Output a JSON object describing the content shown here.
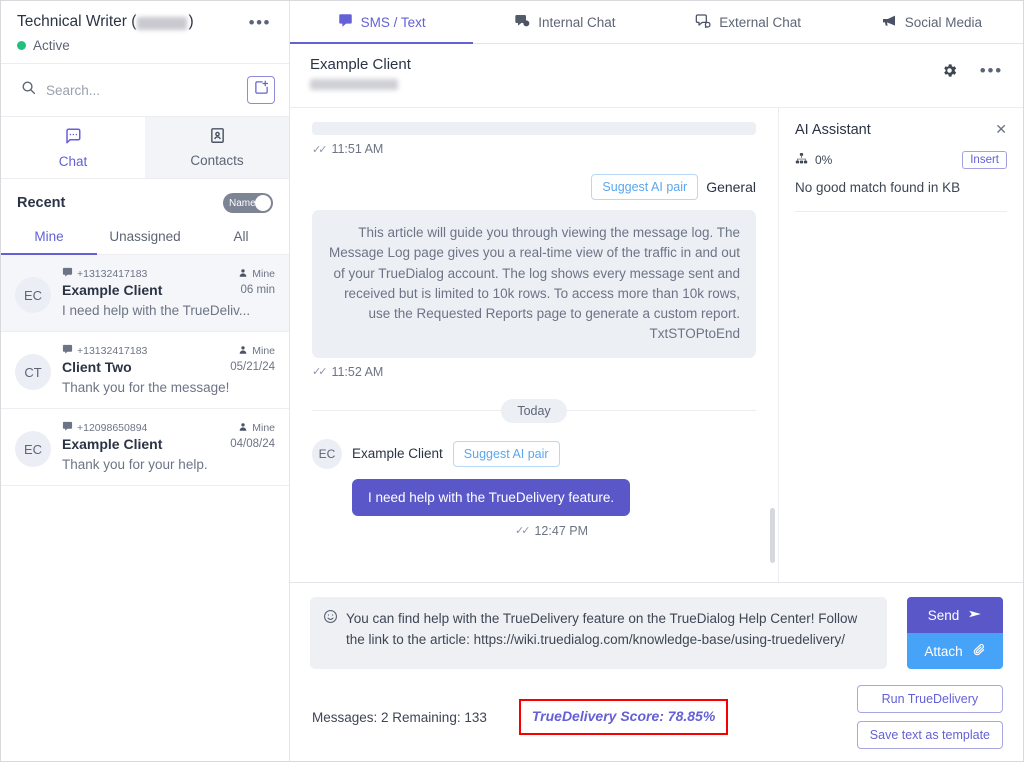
{
  "sidebar": {
    "user": {
      "name": "Technical Writer",
      "number_redacted": true,
      "status": "Active",
      "menu_icon": "ellipsis-icon"
    },
    "search": {
      "placeholder": "Search...",
      "value": "",
      "icon": "search-icon",
      "new_message_icon": "new-message-icon"
    },
    "tabs": [
      {
        "label": "Chat",
        "icon": "chat-bubble-icon",
        "active": true
      },
      {
        "label": "Contacts",
        "icon": "contact-card-icon",
        "active": false
      }
    ],
    "recent_label": "Recent",
    "sort_toggle": {
      "label": "Name",
      "on": true
    },
    "filters": [
      {
        "label": "Mine",
        "active": true
      },
      {
        "label": "Unassigned",
        "active": false
      },
      {
        "label": "All",
        "active": false
      }
    ],
    "conversations": [
      {
        "initials": "EC",
        "phone": "+13132417183",
        "name": "Example Client",
        "owner": "Mine",
        "time": "06 min",
        "preview": "I need help with the TrueDeliv...",
        "selected": true
      },
      {
        "initials": "CT",
        "phone": "+13132417183",
        "name": "Client Two",
        "owner": "Mine",
        "time": "05/21/24",
        "preview": "Thank you for the message!",
        "selected": false
      },
      {
        "initials": "EC",
        "phone": "+12098650894",
        "name": "Example Client",
        "owner": "Mine",
        "time": "04/08/24",
        "preview": "Thank you for your help.",
        "selected": false
      }
    ]
  },
  "channel_tabs": [
    {
      "label": "SMS / Text",
      "icon": "sms-icon",
      "active": true
    },
    {
      "label": "Internal Chat",
      "icon": "internal-chat-icon",
      "active": false
    },
    {
      "label": "External Chat",
      "icon": "external-chat-icon",
      "active": false
    },
    {
      "label": "Social Media",
      "icon": "megaphone-icon",
      "active": false
    }
  ],
  "chat_header": {
    "name": "Example Client",
    "number_redacted": true,
    "gear_icon": "gear-icon",
    "menu_icon": "ellipsis-icon"
  },
  "thread": {
    "messages": [
      {
        "direction": "outbound",
        "text": "",
        "empty": true,
        "time": "11:51 AM",
        "status_icon": "double-check-icon"
      },
      {
        "direction": "outbound",
        "suggest_button": "Suggest AI pair",
        "tag": "General",
        "text": "This article will guide you through viewing the message log. The Message Log page gives you a real-time view of the traffic in and out of your TrueDialog account. The log shows every message sent and received but is limited to 10k rows. To access more than 10k rows, use the Requested Reports page to generate a custom report. TxtSTOPtoEnd",
        "time": "11:52 AM",
        "status_icon": "double-check-icon"
      }
    ],
    "day_divider": "Today",
    "inbound": {
      "initials": "EC",
      "sender": "Example Client",
      "suggest_button": "Suggest AI pair",
      "text": "I need help with the TrueDelivery feature.",
      "time": "12:47 PM",
      "status_icon": "double-check-icon"
    }
  },
  "ai_assistant": {
    "title": "AI Assistant",
    "close_icon": "close-icon",
    "score_icon": "hierarchy-icon",
    "score": "0%",
    "insert_label": "Insert",
    "result": "No good match found in KB"
  },
  "composer": {
    "emoji_icon": "smiley-icon",
    "text": "You can find help with the TrueDelivery feature on the TrueDialog Help Center! Follow the link to the article: https://wiki.truedialog.com/knowledge-base/using-truedelivery/",
    "send_label": "Send",
    "send_icon": "paper-plane-icon",
    "attach_label": "Attach",
    "attach_icon": "paperclip-icon",
    "message_count": "Messages: 2 Remaining: 133",
    "truedelivery_score": "TrueDelivery Score: 78.85%",
    "run_button": "Run TrueDelivery",
    "save_button": "Save text as template"
  },
  "colors": {
    "accent_purple": "#6461d6",
    "bubble_out": "#5a58c8",
    "attach_blue": "#46a3f7",
    "highlight_red": "#f90000",
    "link_blue": "#5ba7ef",
    "active_green": "#22c07e"
  }
}
